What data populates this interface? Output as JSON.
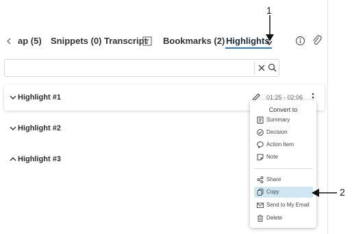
{
  "tabs": [
    {
      "label": "ap (5)"
    },
    {
      "label": "Snippets (0)"
    },
    {
      "label": "Transcript"
    },
    {
      "label": "Bookmarks (2)"
    },
    {
      "label": "Highlights"
    }
  ],
  "search": {
    "value": "",
    "placeholder": ""
  },
  "highlights": [
    {
      "title": "Highlight #1",
      "time": "01:25 - 02:06"
    },
    {
      "title": "Highlight #2"
    },
    {
      "title": "Highlight #3"
    }
  ],
  "menu": {
    "title": "Convert to",
    "convert_items": [
      {
        "label": "Summary"
      },
      {
        "label": "Decision"
      },
      {
        "label": "Action Item"
      },
      {
        "label": "Note"
      }
    ],
    "action_items": [
      {
        "label": "Share"
      },
      {
        "label": "Copy"
      },
      {
        "label": "Send to My Email"
      },
      {
        "label": "Delete"
      }
    ]
  },
  "annotations": {
    "first": "1",
    "second": "2"
  },
  "colors": {
    "accent": "#2a7bd6",
    "selected_bg": "#cfe7f3"
  }
}
